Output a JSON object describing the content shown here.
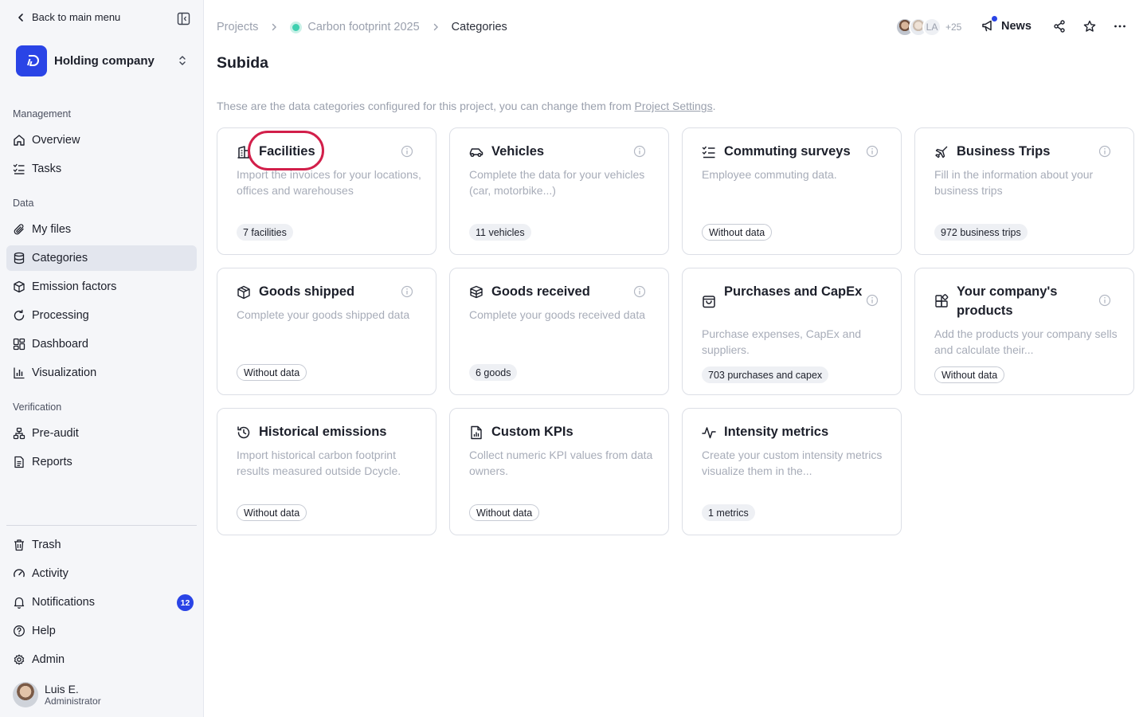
{
  "sidebar": {
    "back_label": "Back to main menu",
    "org_name": "Holding company",
    "sections": {
      "management": "Management",
      "data": "Data",
      "verification": "Verification"
    },
    "items": {
      "overview": "Overview",
      "tasks": "Tasks",
      "my_files": "My files",
      "categories": "Categories",
      "emission_factors": "Emission factors",
      "processing": "Processing",
      "dashboard": "Dashboard",
      "visualization": "Visualization",
      "pre_audit": "Pre-audit",
      "reports": "Reports",
      "trash": "Trash",
      "activity": "Activity",
      "notifications": "Notifications",
      "help": "Help",
      "admin": "Admin"
    },
    "notifications_count": "12",
    "active_item": "categories",
    "user": {
      "name": "Luis E.",
      "role": "Administrator"
    }
  },
  "header": {
    "breadcrumb": [
      "Projects",
      "Carbon footprint 2025",
      "Categories"
    ],
    "avatar_initials": "LA",
    "avatar_more": "+25",
    "news_label": "News"
  },
  "page": {
    "title": "Subida",
    "description": "These are the data categories configured for this project, you can change them from ",
    "settings_link": "Project Settings",
    "description_end": "."
  },
  "cards": [
    {
      "title": "Facilities",
      "icon": "building-icon",
      "description": "Import the invoices for your locations, offices and warehouses",
      "badge": "7 facilities",
      "has_data": true
    },
    {
      "title": "Vehicles",
      "icon": "car-icon",
      "description": "Complete the data for your vehicles (car, motorbike...)",
      "badge": "11 vehicles",
      "has_data": true
    },
    {
      "title": "Commuting surveys",
      "icon": "checklist-icon",
      "description": "Employee commuting data.",
      "badge": "Without data",
      "has_data": false
    },
    {
      "title": "Business Trips",
      "icon": "plane-icon",
      "description": "Fill in the information about your business trips",
      "badge": "972 business trips",
      "has_data": true
    },
    {
      "title": "Goods shipped",
      "icon": "box-icon",
      "description": "Complete your goods shipped data",
      "badge": "Without data",
      "has_data": false
    },
    {
      "title": "Goods received",
      "icon": "boxes-icon",
      "description": "Complete your goods received data",
      "badge": "6 goods",
      "has_data": true
    },
    {
      "title": "Purchases and CapEx",
      "icon": "shopping-bag-icon",
      "description": "Purchase expenses, CapEx and suppliers.",
      "badge": "703 purchases and capex",
      "has_data": true
    },
    {
      "title": "Your company's products",
      "icon": "products-icon",
      "description": "Add the products your company sells and calculate their...",
      "badge": "Without data",
      "has_data": false
    },
    {
      "title": "Historical emissions",
      "icon": "history-icon",
      "description": "Import historical carbon footprint results measured outside Dcycle.",
      "badge": "Without data",
      "has_data": false
    },
    {
      "title": "Custom KPIs",
      "icon": "file-chart-icon",
      "description": "Collect numeric KPI values from data owners.",
      "badge": "Without data",
      "has_data": false
    },
    {
      "title": "Intensity metrics",
      "icon": "activity-icon",
      "description": "Create your custom intensity metrics visualize them in the...",
      "badge": "1 metrics",
      "has_data": true
    }
  ],
  "colors": {
    "accent": "#2a44e6",
    "highlight_ring": "#d21f4a",
    "project_dot": "#3fd0b0"
  }
}
